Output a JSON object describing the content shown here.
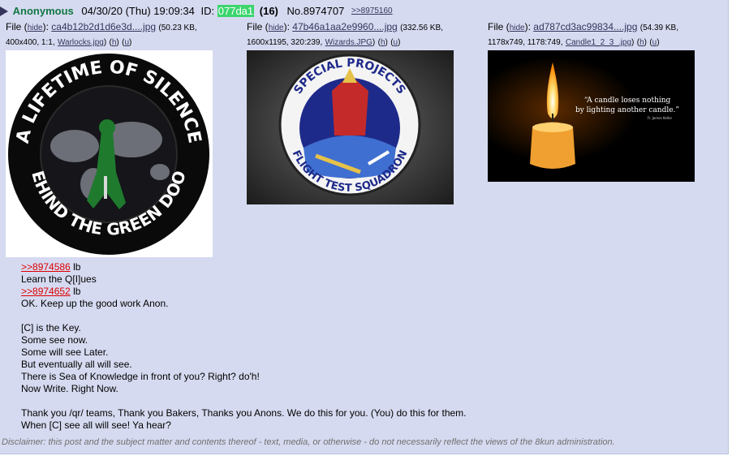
{
  "post": {
    "name": "Anonymous",
    "date": "04/30/20 (Thu) 19:09:34",
    "id_label": "ID:",
    "id": "077da1",
    "id_count": "(16)",
    "post_no": "No.8974707",
    "reply_link": ">>8975160"
  },
  "files": [
    {
      "label": "File",
      "hide": "hide",
      "filename": "ca4b12b2d1d6e3d....jpg",
      "size": "50.23 KB,",
      "dims": "400x400, 1:1,",
      "orig_name": "Warlocks.jpg",
      "h": "h",
      "u": "u",
      "patch_top_text": "A LIFETIME OF SILENCE",
      "patch_bottom_text": "BEHIND THE GREEN DOOR"
    },
    {
      "label": "File",
      "hide": "hide",
      "filename": "47b46a1aa2e9960....jpg",
      "size": "332.56 KB,",
      "dims": "1600x1195, 320:239,",
      "orig_name": "Wizards.JPG",
      "h": "h",
      "u": "u",
      "patch_top_text": "SPECIAL PROJECTS",
      "patch_bottom_text": "FLIGHT TEST SQUADRON"
    },
    {
      "label": "File",
      "hide": "hide",
      "filename": "ad787cd3ac99834....jpg",
      "size": "54.39 KB,",
      "dims": "1178x749, 1178:749,",
      "orig_name": "Candle1_2_3_.jpg",
      "h": "h",
      "u": "u",
      "quote_line1": "“A candle loses nothing",
      "quote_line2": "by lighting another candle.”",
      "quote_author": "Fr. James Keller"
    }
  ],
  "body": {
    "l1_link": ">>8974586",
    "l1_text": " lb",
    "l2": "Learn the Q[I]ues",
    "l3_link": ">>8974652",
    "l3_text": " lb",
    "l4": "OK. Keep up the good work Anon.",
    "l5": "[C] is the Key.",
    "l6": "Some see now.",
    "l7": "Some will see Later.",
    "l8": "But eventually all will see.",
    "l9": "There is Sea of Knowledge in front of you? Right? do'h!",
    "l10": "Now Write. Right Now.",
    "l11": "Thank you /qr/ teams, Thank you Bakers, Thanks you Anons. We do this for you. (You) do this for them.",
    "l12": "When [C] see all will see! Ya hear?"
  },
  "disclaimer": "Disclaimer: this post and the subject matter and contents thereof - text, media, or otherwise - do not necessarily reflect the views of the 8kun administration.",
  "colors": {
    "post_bg": "#d6daf0",
    "name": "#117743",
    "id_badge": "#3cd56e",
    "quote_link": "#dd0000",
    "link": "#34345c"
  }
}
